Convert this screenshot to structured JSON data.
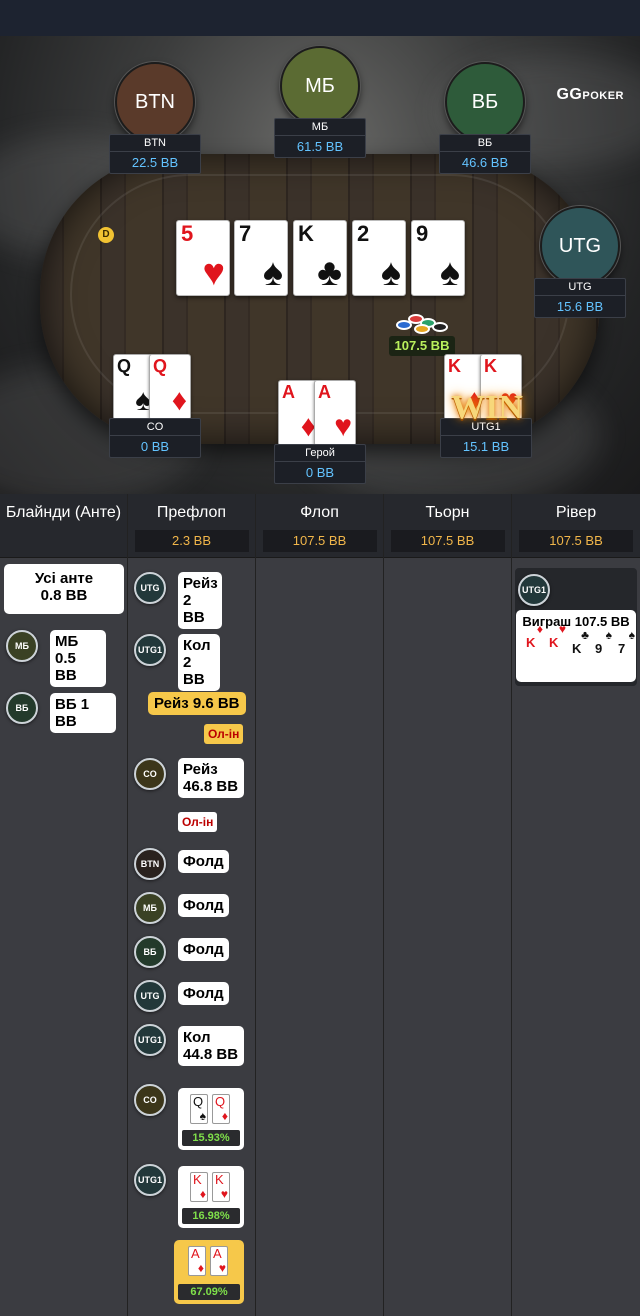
{
  "brand": {
    "logo": "GG",
    "logo_sub": "POKER"
  },
  "seats": {
    "btn": {
      "avatar": "BTN",
      "name": "BTN",
      "stack": "22.5 BB",
      "color": "#5a3a2a"
    },
    "sb": {
      "avatar": "МБ",
      "name": "МБ",
      "stack": "61.5 BB",
      "color": "#5b6b33"
    },
    "bb": {
      "avatar": "ВБ",
      "name": "ВБ",
      "stack": "46.6 BB",
      "color": "#2e5b3a"
    },
    "utg": {
      "avatar": "UTG",
      "name": "UTG",
      "stack": "15.6 BB",
      "color": "#2f5559"
    },
    "co": {
      "name": "CO",
      "stack": "0 BB"
    },
    "hero": {
      "name": "Герой",
      "stack": "0 BB"
    },
    "utg1": {
      "name": "UTG1",
      "stack": "15.1 BB"
    }
  },
  "dealer_label": "D",
  "board": [
    {
      "rank": "5",
      "suit": "♥"
    },
    {
      "rank": "7",
      "suit": "♠"
    },
    {
      "rank": "K",
      "suit": "♣"
    },
    {
      "rank": "2",
      "suit": "♠"
    },
    {
      "rank": "9",
      "suit": "♠"
    }
  ],
  "hands": {
    "co": [
      {
        "rank": "Q",
        "suit": "♠"
      },
      {
        "rank": "Q",
        "suit": "♦"
      }
    ],
    "hero": [
      {
        "rank": "A",
        "suit": "♦"
      },
      {
        "rank": "A",
        "suit": "♥"
      }
    ],
    "utg1": [
      {
        "rank": "K",
        "suit": "♦"
      },
      {
        "rank": "K",
        "suit": "♥"
      }
    ]
  },
  "pot": "107.5 BB",
  "win_label": "WIN",
  "streets": {
    "blinds": {
      "title": "Блайнди (Анте)"
    },
    "preflop": {
      "title": "Префлоп",
      "pot": "2.3 BB"
    },
    "flop": {
      "title": "Флоп",
      "pot": "107.5 BB"
    },
    "turn": {
      "title": "Тьорн",
      "pot": "107.5 BB"
    },
    "river": {
      "title": "Рівер",
      "pot": "107.5 BB"
    }
  },
  "blinds_actions": {
    "ante_all": "Усі анте",
    "ante_amount": "0.8 BB",
    "sb_pos": "МБ",
    "sb_text1": "МБ",
    "sb_text2": "0.5 BB",
    "bb_pos": "ВБ",
    "bb_text": "ВБ 1 BB"
  },
  "preflop_actions": {
    "a1_pos": "UTG",
    "a1_l1": "Рейз",
    "a1_l2": "2 BB",
    "a2_pos": "UTG1",
    "a2_l1": "Кол",
    "a2_l2": "2 BB",
    "hero_raise": "Рейз 9.6 BB",
    "hero_allin": "Ол-ін",
    "a4_pos": "CO",
    "a4_l1": "Рейз",
    "a4_l2": "46.8 BB",
    "a4_allin": "Ол-ін",
    "f1_pos": "BTN",
    "f1": "Фолд",
    "f2_pos": "МБ",
    "f2": "Фолд",
    "f3_pos": "ВБ",
    "f3": "Фолд",
    "f4_pos": "UTG",
    "f4": "Фолд",
    "a9_pos": "UTG1",
    "a9_l1": "Кол",
    "a9_l2": "44.8 BB",
    "eq1_pos": "CO",
    "eq1": "15.93%",
    "eq2_pos": "UTG1",
    "eq2": "16.98%",
    "eq3": "67.09%"
  },
  "river_actions": {
    "pos": "UTG1",
    "won": "Виграш 107.5 BB"
  }
}
